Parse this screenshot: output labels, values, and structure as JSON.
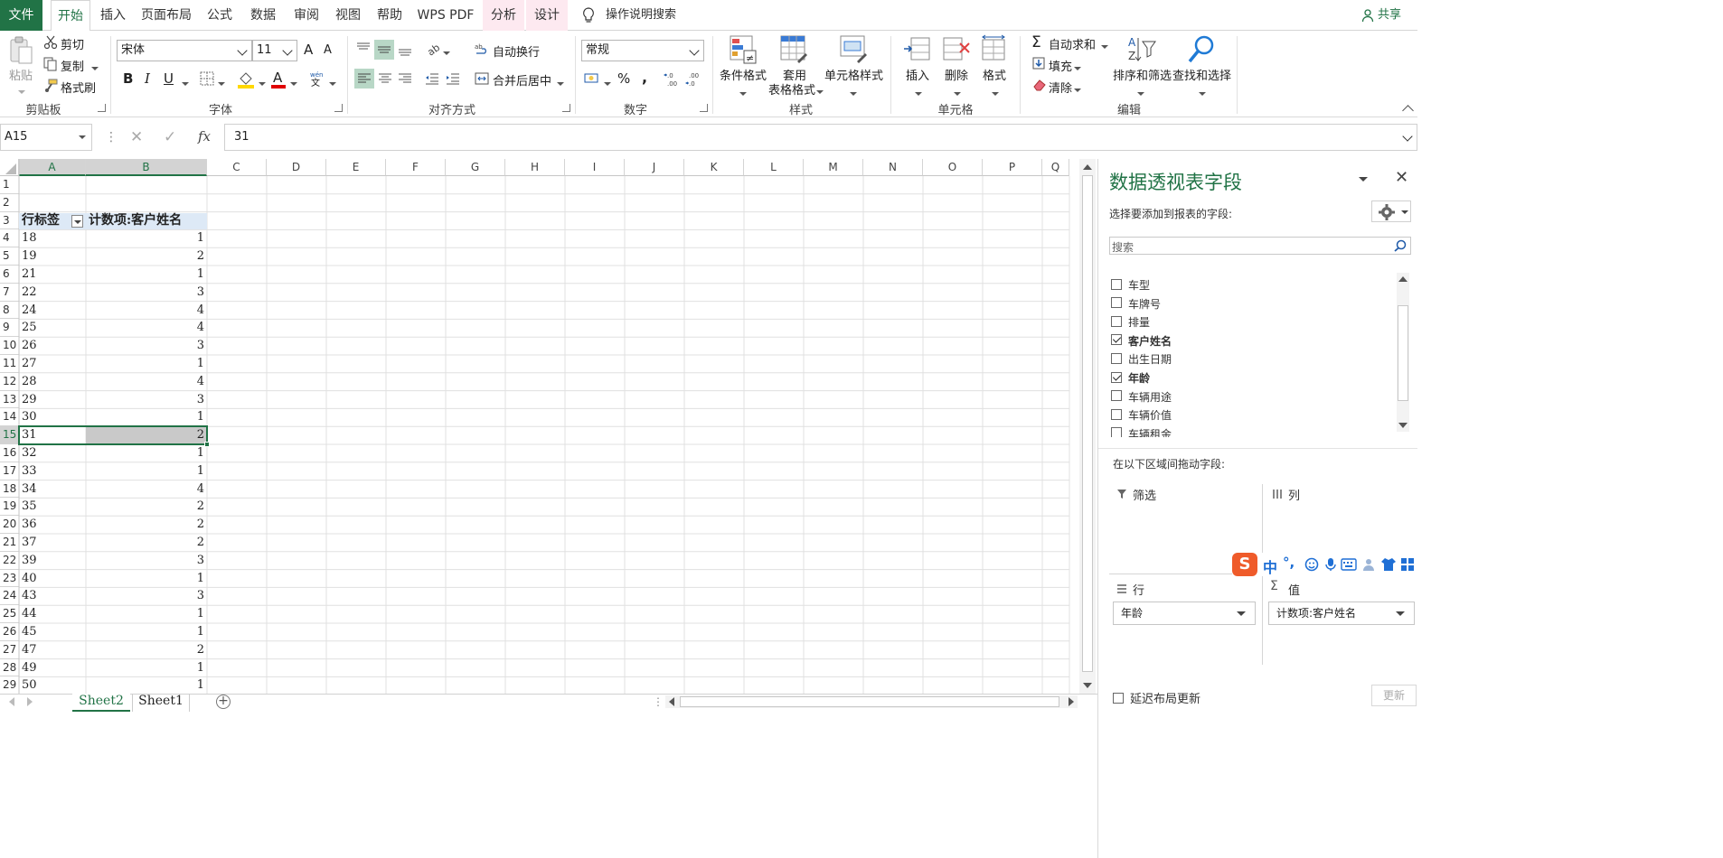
{
  "tabs": [
    "文件",
    "开始",
    "插入",
    "页面布局",
    "公式",
    "数据",
    "审阅",
    "视图",
    "帮助",
    "WPS PDF",
    "分析",
    "设计"
  ],
  "tell_me": "操作说明搜索",
  "share": "共享",
  "ribbon": {
    "clipboard": {
      "paste": "粘贴",
      "cut": "剪切",
      "copy": "复制",
      "format_painter": "格式刷",
      "label": "剪贴板"
    },
    "font": {
      "name": "宋体",
      "size": "11",
      "bold": "B",
      "italic": "I",
      "underline": "U",
      "grow": "A",
      "shrink": "A",
      "label": "字体"
    },
    "align": {
      "wrap": "自动换行",
      "merge": "合并后居中",
      "label": "对齐方式"
    },
    "number": {
      "format": "常规",
      "percent": "%",
      "comma": ",",
      "label": "数字"
    },
    "styles": {
      "conditional": "条件格式",
      "table_a": "套用",
      "table_b": "表格格式",
      "cell": "单元格样式",
      "label": "样式"
    },
    "cells": {
      "insert": "插入",
      "delete": "删除",
      "format": "格式",
      "label": "单元格"
    },
    "editing": {
      "autosum": "自动求和",
      "fill": "填充",
      "clear": "清除",
      "sort": "排序和筛选",
      "find": "查找和选择",
      "label": "编辑"
    }
  },
  "formula_bar": {
    "name_box": "A15",
    "cancel": "✕",
    "enter": "✓",
    "fx": "fx",
    "value": "31"
  },
  "columns": [
    "A",
    "B",
    "C",
    "D",
    "E",
    "F",
    "G",
    "H",
    "I",
    "J",
    "K",
    "L",
    "M",
    "N",
    "O",
    "P",
    "Q"
  ],
  "rows": [
    "1",
    "2",
    "3",
    "4",
    "5",
    "6",
    "7",
    "8",
    "9",
    "10",
    "11",
    "12",
    "13",
    "14",
    "15",
    "16",
    "17",
    "18",
    "19",
    "20",
    "21",
    "22",
    "23",
    "24",
    "25",
    "26",
    "27",
    "28",
    "29"
  ],
  "pivot": {
    "header_a": "行标签",
    "header_b": "计数项:客户姓名",
    "data": [
      [
        "18",
        "1"
      ],
      [
        "19",
        "2"
      ],
      [
        "21",
        "1"
      ],
      [
        "22",
        "3"
      ],
      [
        "24",
        "4"
      ],
      [
        "25",
        "4"
      ],
      [
        "26",
        "3"
      ],
      [
        "27",
        "1"
      ],
      [
        "28",
        "4"
      ],
      [
        "29",
        "3"
      ],
      [
        "30",
        "1"
      ],
      [
        "31",
        "2"
      ],
      [
        "32",
        "1"
      ],
      [
        "33",
        "1"
      ],
      [
        "34",
        "4"
      ],
      [
        "35",
        "2"
      ],
      [
        "36",
        "2"
      ],
      [
        "37",
        "2"
      ],
      [
        "39",
        "3"
      ],
      [
        "40",
        "1"
      ],
      [
        "43",
        "3"
      ],
      [
        "44",
        "1"
      ],
      [
        "45",
        "1"
      ],
      [
        "47",
        "2"
      ],
      [
        "49",
        "1"
      ],
      [
        "50",
        "1"
      ]
    ]
  },
  "sheets": [
    "Sheet2",
    "Sheet1"
  ],
  "panel": {
    "title": "数据透视表字段",
    "choose": "选择要添加到报表的字段:",
    "search_placeholder": "搜索",
    "fields": [
      {
        "label": "车型",
        "checked": false
      },
      {
        "label": "车牌号",
        "checked": false
      },
      {
        "label": "排量",
        "checked": false
      },
      {
        "label": "客户姓名",
        "checked": true
      },
      {
        "label": "出生日期",
        "checked": false
      },
      {
        "label": "年龄",
        "checked": true
      },
      {
        "label": "车辆用途",
        "checked": false
      },
      {
        "label": "车辆价值",
        "checked": false
      },
      {
        "label": "车辆租金",
        "checked": false
      }
    ],
    "drag_hint": "在以下区域间拖动字段:",
    "filter": "筛选",
    "columns": "列",
    "rows": "行",
    "values": "值",
    "row_field": "年龄",
    "value_field": "计数项:客户姓名",
    "defer": "延迟布局更新",
    "update": "更新"
  },
  "ime": {
    "lang": "中",
    "punct": "°,"
  }
}
